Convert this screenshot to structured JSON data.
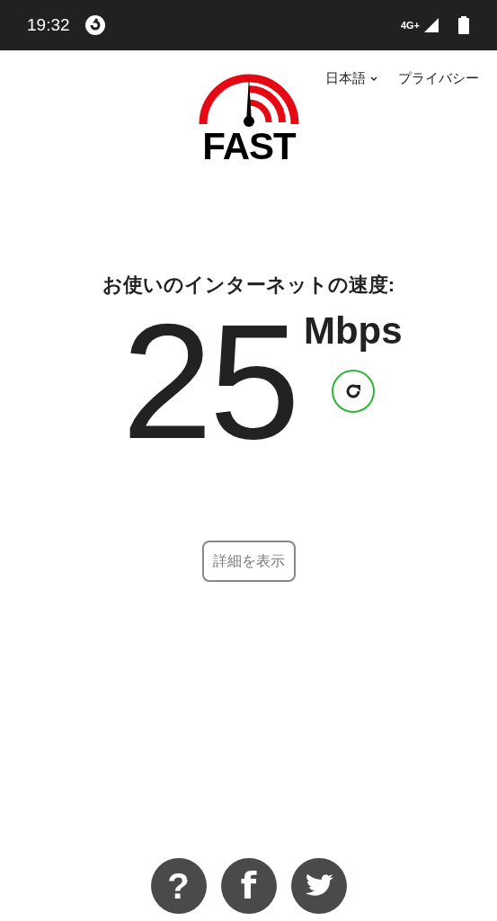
{
  "status_bar": {
    "time": "19:32",
    "network": "4G+"
  },
  "header": {
    "logo_text": "FAST",
    "language": "日本語",
    "privacy": "プライバシー"
  },
  "speed": {
    "label": "お使いのインターネットの速度:",
    "value": "25",
    "unit": "Mbps"
  },
  "details_button": "詳細を表示",
  "footer": [
    {
      "kind": "help",
      "label": "?"
    },
    {
      "kind": "facebook",
      "label": "f"
    },
    {
      "kind": "bird"
    }
  ]
}
